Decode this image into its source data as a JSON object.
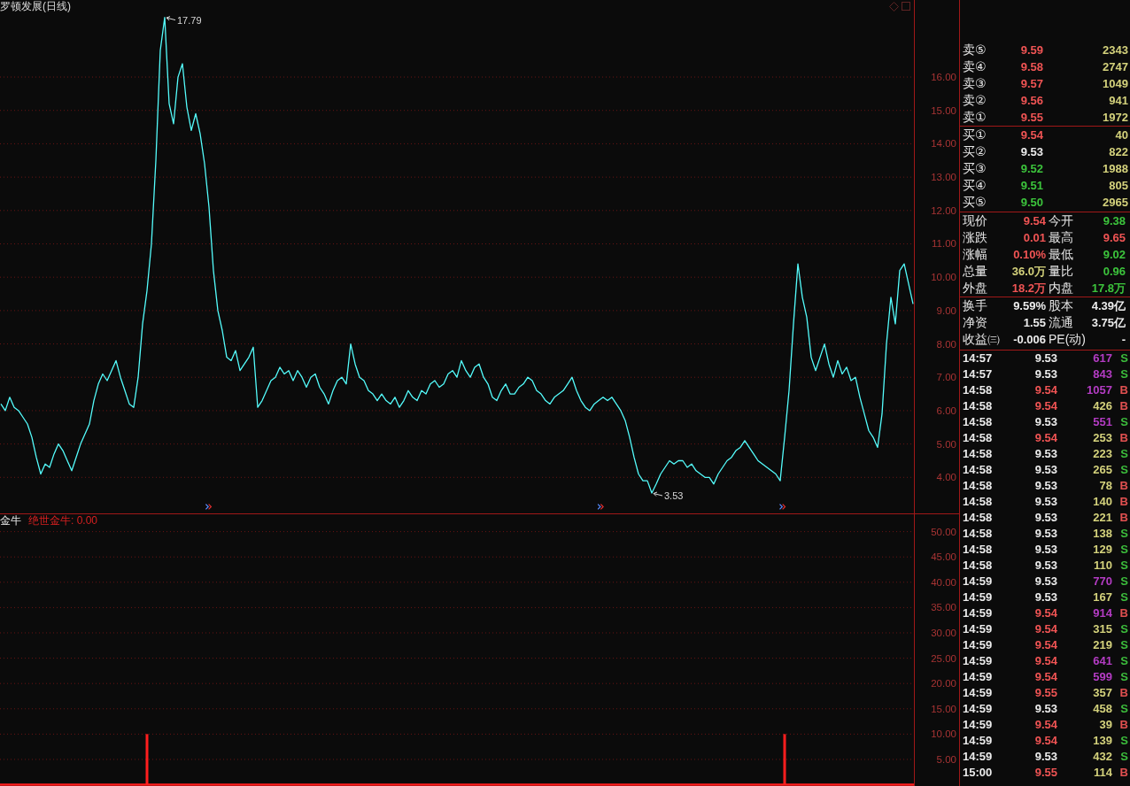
{
  "chart": {
    "title": "罗顿发展(日线)",
    "chart_data": {
      "type": "line",
      "ylim": [
        2.92,
        18.31
      ],
      "yticks": [
        {
          "value": 4,
          "label": "4.00"
        },
        {
          "value": 5,
          "label": "5.00"
        },
        {
          "value": 6,
          "label": "6.00"
        },
        {
          "value": 7,
          "label": "7.00"
        },
        {
          "value": 8,
          "label": "8.00"
        },
        {
          "value": 9,
          "label": "9.00"
        },
        {
          "value": 10,
          "label": "10.00"
        },
        {
          "value": 11,
          "label": "11.00"
        },
        {
          "value": 12,
          "label": "12.00"
        },
        {
          "value": 13,
          "label": "13.00"
        },
        {
          "value": 14,
          "label": "14.00"
        },
        {
          "value": 15,
          "label": "15.00"
        },
        {
          "value": 16,
          "label": "16.00"
        }
      ],
      "grid": true,
      "series": [
        {
          "color": "#54fcfc",
          "values": [
            6.2,
            6.0,
            6.4,
            6.1,
            6.0,
            5.8,
            5.6,
            5.2,
            4.6,
            4.1,
            4.4,
            4.3,
            4.7,
            5.0,
            4.8,
            4.5,
            4.2,
            4.6,
            5.0,
            5.3,
            5.6,
            6.3,
            6.8,
            7.1,
            6.9,
            7.2,
            7.5,
            7.0,
            6.6,
            6.2,
            6.1,
            7.0,
            8.6,
            9.6,
            11.0,
            13.5,
            16.8,
            17.79,
            15.2,
            14.6,
            16.0,
            16.4,
            15.1,
            14.4,
            14.9,
            14.3,
            13.4,
            12.1,
            10.2,
            9.0,
            8.4,
            7.6,
            7.5,
            7.8,
            7.2,
            7.4,
            7.6,
            7.9,
            6.1,
            6.3,
            6.6,
            6.9,
            7.0,
            7.3,
            7.1,
            7.2,
            6.9,
            7.2,
            7.0,
            6.7,
            7.0,
            7.1,
            6.7,
            6.5,
            6.2,
            6.6,
            6.9,
            7.0,
            6.8,
            8.0,
            7.4,
            7.0,
            6.9,
            6.6,
            6.5,
            6.3,
            6.5,
            6.3,
            6.2,
            6.4,
            6.1,
            6.3,
            6.6,
            6.4,
            6.3,
            6.6,
            6.5,
            6.8,
            6.9,
            6.7,
            6.8,
            7.1,
            7.2,
            7.0,
            7.5,
            7.2,
            7.0,
            7.3,
            7.4,
            7.0,
            6.8,
            6.4,
            6.3,
            6.6,
            6.8,
            6.5,
            6.5,
            6.7,
            6.8,
            7.0,
            6.9,
            6.6,
            6.5,
            6.3,
            6.2,
            6.4,
            6.5,
            6.6,
            6.8,
            7.0,
            6.6,
            6.3,
            6.1,
            6.0,
            6.2,
            6.3,
            6.4,
            6.3,
            6.4,
            6.2,
            6.0,
            5.7,
            5.2,
            4.6,
            4.1,
            3.9,
            3.9,
            3.53,
            3.8,
            4.1,
            4.3,
            4.5,
            4.4,
            4.5,
            4.5,
            4.3,
            4.4,
            4.2,
            4.1,
            4.0,
            4.0,
            3.8,
            4.1,
            4.3,
            4.5,
            4.6,
            4.8,
            4.9,
            5.1,
            4.9,
            4.7,
            4.5,
            4.4,
            4.3,
            4.2,
            4.1,
            3.9,
            5.2,
            6.6,
            8.6,
            10.4,
            9.4,
            8.8,
            7.6,
            7.2,
            7.6,
            8.0,
            7.4,
            7.0,
            7.5,
            7.1,
            7.3,
            6.9,
            7.0,
            6.4,
            5.9,
            5.4,
            5.2,
            4.9,
            5.9,
            8.0,
            9.4,
            8.6,
            10.2,
            10.4,
            9.8,
            9.2
          ]
        }
      ],
      "annotations": [
        "17.79",
        "3.53"
      ]
    }
  },
  "indicator": {
    "name": "金牛",
    "reading": "绝世金牛: 0.00",
    "chart_data": {
      "type": "bar",
      "ylim": [
        -0.25,
        53.43
      ],
      "yticks": [
        {
          "value": 5,
          "label": "5.00"
        },
        {
          "value": 10,
          "label": "10.00"
        },
        {
          "value": 15,
          "label": "15.00"
        },
        {
          "value": 20,
          "label": "20.00"
        },
        {
          "value": 25,
          "label": "25.00"
        },
        {
          "value": 30,
          "label": "30.00"
        },
        {
          "value": 35,
          "label": "35.00"
        },
        {
          "value": 40,
          "label": "40.00"
        },
        {
          "value": 45,
          "label": "45.00"
        },
        {
          "value": 50,
          "label": "50.00"
        }
      ],
      "grid": true,
      "series": [
        {
          "color": "#ff1e1e",
          "values": [
            0,
            0,
            0,
            0,
            0,
            0,
            0,
            0,
            0,
            0,
            0,
            0,
            0,
            0,
            0,
            0,
            0,
            0,
            0,
            0,
            0,
            0,
            0,
            0,
            0,
            0,
            0,
            0,
            0,
            0,
            0,
            0,
            0,
            10,
            0,
            0,
            0,
            0,
            0,
            0,
            0,
            0,
            0,
            0,
            0,
            0,
            0,
            0,
            0,
            0,
            0,
            0,
            0,
            0,
            0,
            0,
            0,
            0,
            0,
            0,
            0,
            0,
            0,
            0,
            0,
            0,
            0,
            0,
            0,
            0,
            0,
            0,
            0,
            0,
            0,
            0,
            0,
            0,
            0,
            0,
            0,
            0,
            0,
            0,
            0,
            0,
            0,
            0,
            0,
            0,
            0,
            0,
            0,
            0,
            0,
            0,
            0,
            0,
            0,
            0,
            0,
            0,
            0,
            0,
            0,
            0,
            0,
            0,
            0,
            0,
            0,
            0,
            0,
            0,
            0,
            0,
            0,
            0,
            0,
            0,
            0,
            0,
            0,
            0,
            0,
            0,
            0,
            0,
            0,
            0,
            0,
            0,
            0,
            0,
            0,
            0,
            0,
            0,
            0,
            0,
            0,
            0,
            0,
            0,
            0,
            0,
            0,
            0,
            0,
            0,
            0,
            0,
            0,
            0,
            0,
            0,
            0,
            0,
            0,
            0,
            0,
            0,
            0,
            0,
            0,
            0,
            0,
            0,
            0,
            0,
            0,
            0,
            0,
            0,
            0,
            0,
            0,
            10,
            0,
            0,
            0,
            0,
            0,
            0,
            0,
            0,
            0,
            0,
            0,
            0,
            0,
            0,
            0,
            0,
            0,
            0,
            0,
            0,
            0,
            0,
            0,
            0,
            0,
            0,
            0,
            0,
            0
          ]
        }
      ]
    }
  },
  "quote": {
    "asks": [
      {
        "label": "卖⑤",
        "price": "9.59",
        "color": "#f05454",
        "volume": "2343"
      },
      {
        "label": "卖④",
        "price": "9.58",
        "color": "#f05454",
        "volume": "2747"
      },
      {
        "label": "卖③",
        "price": "9.57",
        "color": "#f05454",
        "volume": "1049"
      },
      {
        "label": "卖②",
        "price": "9.56",
        "color": "#f05454",
        "volume": "941"
      },
      {
        "label": "卖①",
        "price": "9.55",
        "color": "#f05454",
        "volume": "1972"
      }
    ],
    "bids": [
      {
        "label": "买①",
        "price": "9.54",
        "color": "#f05454",
        "volume": "40"
      },
      {
        "label": "买②",
        "price": "9.53",
        "color": "#ececec",
        "volume": "822"
      },
      {
        "label": "买③",
        "price": "9.52",
        "color": "#3cc43c",
        "volume": "1988"
      },
      {
        "label": "买④",
        "price": "9.51",
        "color": "#3cc43c",
        "volume": "805"
      },
      {
        "label": "买⑤",
        "price": "9.50",
        "color": "#3cc43c",
        "volume": "2965"
      }
    ],
    "stats": [
      {
        "label": "现价",
        "value": "9.54",
        "color": "#f05454"
      },
      {
        "label": "今开",
        "value": "9.38",
        "color": "#3cc43c"
      },
      {
        "label": "涨跌",
        "value": "0.01",
        "color": "#f05454"
      },
      {
        "label": "最高",
        "value": "9.65",
        "color": "#f05454"
      },
      {
        "label": "涨幅",
        "value": "0.10%",
        "color": "#f05454"
      },
      {
        "label": "最低",
        "value": "9.02",
        "color": "#3cc43c"
      },
      {
        "label": "总量",
        "value": "36.0万",
        "color": "#d4d27c"
      },
      {
        "label": "量比",
        "value": "0.96",
        "color": "#3cc43c"
      },
      {
        "label": "外盘",
        "value": "18.2万",
        "color": "#f05454"
      },
      {
        "label": "内盘",
        "value": "17.8万",
        "color": "#3cc43c"
      }
    ],
    "fundamentals": [
      {
        "label": "换手",
        "value": "9.59%"
      },
      {
        "label": "股本",
        "value": "4.39亿"
      },
      {
        "label": "净资",
        "value": "1.55"
      },
      {
        "label": "流通",
        "value": "3.75亿"
      },
      {
        "label": "收益㈢",
        "value": "-0.006"
      },
      {
        "label": "PE(动)",
        "value": "-"
      }
    ],
    "ticks": [
      {
        "time": "14:57",
        "price": "9.53",
        "color": "#ececec",
        "volume": "617",
        "large": true,
        "flag": "S",
        "buy": false
      },
      {
        "time": "14:57",
        "price": "9.53",
        "color": "#ececec",
        "volume": "843",
        "large": true,
        "flag": "S",
        "buy": false
      },
      {
        "time": "14:58",
        "price": "9.54",
        "color": "#f05454",
        "volume": "1057",
        "large": true,
        "flag": "B",
        "buy": true
      },
      {
        "time": "14:58",
        "price": "9.54",
        "color": "#f05454",
        "volume": "426",
        "large": false,
        "flag": "B",
        "buy": true
      },
      {
        "time": "14:58",
        "price": "9.53",
        "color": "#ececec",
        "volume": "551",
        "large": true,
        "flag": "S",
        "buy": false
      },
      {
        "time": "14:58",
        "price": "9.54",
        "color": "#f05454",
        "volume": "253",
        "large": false,
        "flag": "B",
        "buy": true
      },
      {
        "time": "14:58",
        "price": "9.53",
        "color": "#ececec",
        "volume": "223",
        "large": false,
        "flag": "S",
        "buy": false
      },
      {
        "time": "14:58",
        "price": "9.53",
        "color": "#ececec",
        "volume": "265",
        "large": false,
        "flag": "S",
        "buy": false
      },
      {
        "time": "14:58",
        "price": "9.53",
        "color": "#ececec",
        "volume": "78",
        "large": false,
        "flag": "B",
        "buy": true
      },
      {
        "time": "14:58",
        "price": "9.53",
        "color": "#ececec",
        "volume": "140",
        "large": false,
        "flag": "B",
        "buy": true
      },
      {
        "time": "14:58",
        "price": "9.53",
        "color": "#ececec",
        "volume": "221",
        "large": false,
        "flag": "B",
        "buy": true
      },
      {
        "time": "14:58",
        "price": "9.53",
        "color": "#ececec",
        "volume": "138",
        "large": false,
        "flag": "S",
        "buy": false
      },
      {
        "time": "14:58",
        "price": "9.53",
        "color": "#ececec",
        "volume": "129",
        "large": false,
        "flag": "S",
        "buy": false
      },
      {
        "time": "14:58",
        "price": "9.53",
        "color": "#ececec",
        "volume": "110",
        "large": false,
        "flag": "S",
        "buy": false
      },
      {
        "time": "14:59",
        "price": "9.53",
        "color": "#ececec",
        "volume": "770",
        "large": true,
        "flag": "S",
        "buy": false
      },
      {
        "time": "14:59",
        "price": "9.53",
        "color": "#ececec",
        "volume": "167",
        "large": false,
        "flag": "S",
        "buy": false
      },
      {
        "time": "14:59",
        "price": "9.54",
        "color": "#f05454",
        "volume": "914",
        "large": true,
        "flag": "B",
        "buy": true
      },
      {
        "time": "14:59",
        "price": "9.54",
        "color": "#f05454",
        "volume": "315",
        "large": false,
        "flag": "S",
        "buy": false
      },
      {
        "time": "14:59",
        "price": "9.54",
        "color": "#f05454",
        "volume": "219",
        "large": false,
        "flag": "S",
        "buy": false
      },
      {
        "time": "14:59",
        "price": "9.54",
        "color": "#f05454",
        "volume": "641",
        "large": true,
        "flag": "S",
        "buy": false
      },
      {
        "time": "14:59",
        "price": "9.54",
        "color": "#f05454",
        "volume": "599",
        "large": true,
        "flag": "S",
        "buy": false
      },
      {
        "time": "14:59",
        "price": "9.55",
        "color": "#f05454",
        "volume": "357",
        "large": false,
        "flag": "B",
        "buy": true
      },
      {
        "time": "14:59",
        "price": "9.53",
        "color": "#ececec",
        "volume": "458",
        "large": false,
        "flag": "S",
        "buy": false
      },
      {
        "time": "14:59",
        "price": "9.54",
        "color": "#f05454",
        "volume": "39",
        "large": false,
        "flag": "B",
        "buy": true
      },
      {
        "time": "14:59",
        "price": "9.54",
        "color": "#f05454",
        "volume": "139",
        "large": false,
        "flag": "S",
        "buy": false
      },
      {
        "time": "14:59",
        "price": "9.53",
        "color": "#ececec",
        "volume": "432",
        "large": false,
        "flag": "S",
        "buy": false
      },
      {
        "time": "15:00",
        "price": "9.55",
        "color": "#f05454",
        "volume": "114",
        "large": false,
        "flag": "B",
        "buy": true
      }
    ]
  }
}
